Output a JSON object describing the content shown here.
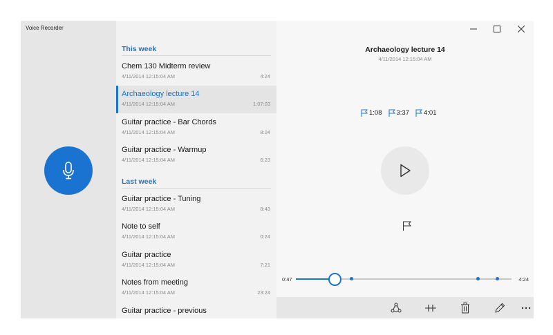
{
  "app": {
    "title": "Voice Recorder"
  },
  "colors": {
    "accent": "#1a73d0"
  },
  "icons": {
    "record": "microphone-icon",
    "play": "play-icon",
    "flag": "flag-icon"
  },
  "groups": [
    {
      "label": "This week"
    },
    {
      "label": "Last week"
    }
  ],
  "recordings": [
    {
      "name": "Chem 130 Midterm review",
      "date": "4/11/2014 12:15:04 AM",
      "duration": "4:24"
    },
    {
      "name": "Archaeology lecture 14",
      "date": "4/11/2014 12:15:04 AM",
      "duration": "1:07:03"
    },
    {
      "name": "Guitar practice - Bar Chords",
      "date": "4/11/2014 12:15:04 AM",
      "duration": "8:04"
    },
    {
      "name": "Guitar practice - Warmup",
      "date": "4/11/2014 12:15:04 AM",
      "duration": "6:23"
    },
    {
      "name": "Guitar practice - Tuning",
      "date": "4/11/2014 12:15:04 AM",
      "duration": "8:43"
    },
    {
      "name": "Note to self",
      "date": "4/11/2014 12:15:04 AM",
      "duration": "0:24"
    },
    {
      "name": "Guitar practice",
      "date": "4/11/2014 12:15:04 AM",
      "duration": "7:21"
    },
    {
      "name": "Notes from meeting",
      "date": "4/11/2014 12:15:04 AM",
      "duration": "23:24"
    },
    {
      "name": "Guitar practice - previous",
      "date": "",
      "duration": ""
    }
  ],
  "selected": {
    "title": "Archaeology lecture 14",
    "date": "4/11/2014 12:15:04 AM",
    "markers": [
      "1:08",
      "3:37",
      "4:01"
    ]
  },
  "playback": {
    "current": "0:47",
    "total": "4:24",
    "progress": 0.178,
    "marker_positions": [
      0.258,
      0.843,
      0.934
    ]
  },
  "window_controls": {
    "minimize": "—",
    "maximize": "☐",
    "close": "✕"
  }
}
